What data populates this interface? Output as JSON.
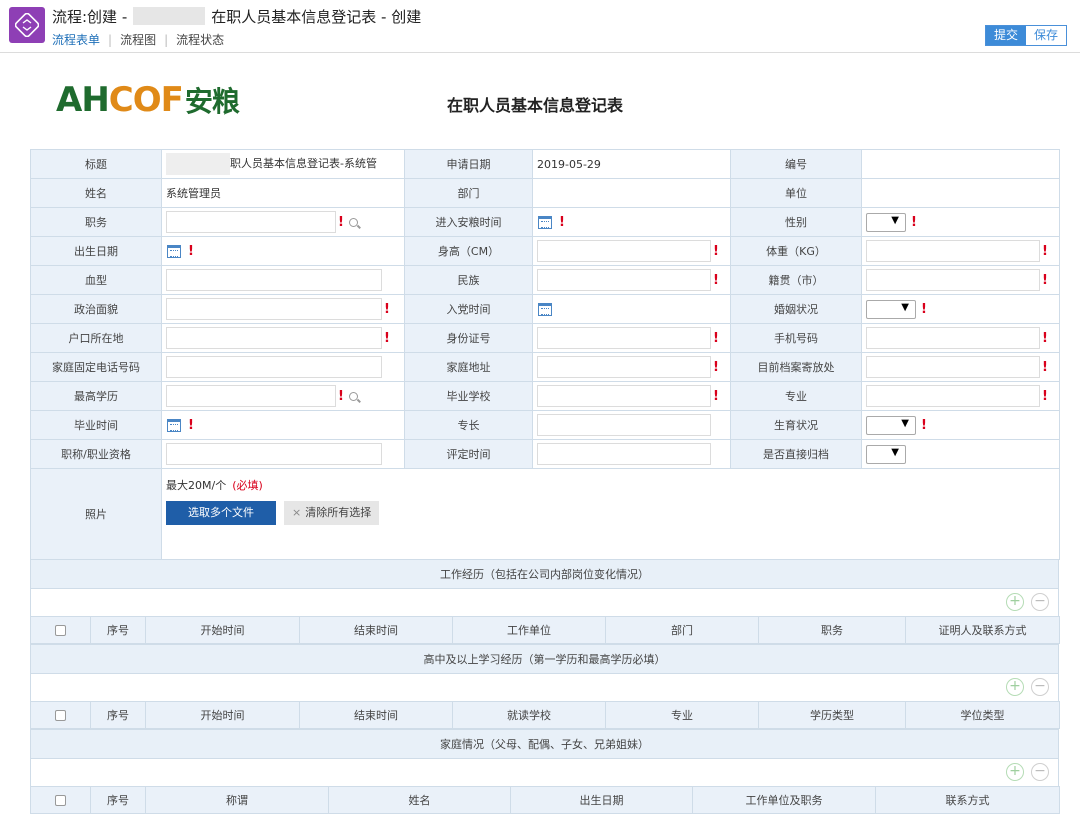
{
  "header": {
    "title_prefix": "流程:创建 -",
    "title_suffix": "在职人员基本信息登记表 - 创建",
    "tabs": [
      "流程表单",
      "流程图",
      "流程状态"
    ],
    "submit_label": "提交",
    "save_label": "保存"
  },
  "logo": {
    "ah": "AH",
    "cof": "COF",
    "cn": "安粮"
  },
  "form_title": "在职人员基本信息登记表",
  "form": {
    "title_label": "标题",
    "title_value": "职人员基本信息登记表-系统管",
    "apply_date_label": "申请日期",
    "apply_date_value": "2019-05-29",
    "number_label": "编号",
    "name_label": "姓名",
    "name_value": "系统管理员",
    "dept_label": "部门",
    "unit_label": "单位",
    "position_label": "职务",
    "join_date_label": "进入安粮时间",
    "gender_label": "性别",
    "birth_label": "出生日期",
    "height_label": "身高（CM）",
    "weight_label": "体重（KG）",
    "blood_label": "血型",
    "ethnic_label": "民族",
    "native_label": "籍贯（市）",
    "political_label": "政治面貌",
    "party_date_label": "入党时间",
    "marital_label": "婚姻状况",
    "hukou_label": "户口所在地",
    "id_label": "身份证号",
    "mobile_label": "手机号码",
    "home_phone_label": "家庭固定电话号码",
    "home_addr_label": "家庭地址",
    "archive_label": "目前档案寄放处",
    "edu_label": "最高学历",
    "school_label": "毕业学校",
    "major_label": "专业",
    "grad_date_label": "毕业时间",
    "specialty_label": "专长",
    "fertility_label": "生育状况",
    "title_qual_label": "职称/职业资格",
    "eval_date_label": "评定时间",
    "direct_archive_label": "是否直接归档",
    "photo_label": "照片",
    "photo_hint": "最大20M/个",
    "photo_required": "(必填)",
    "pick_files": "选取多个文件",
    "clear_all": "清除所有选择"
  },
  "work_history": {
    "title": "工作经历（包括在公司内部岗位变化情况）",
    "columns": [
      "序号",
      "开始时间",
      "结束时间",
      "工作单位",
      "部门",
      "职务",
      "证明人及联系方式"
    ]
  },
  "education": {
    "title": "高中及以上学习经历（第一学历和最高学历必填）",
    "columns": [
      "序号",
      "开始时间",
      "结束时间",
      "就读学校",
      "专业",
      "学历类型",
      "学位类型"
    ]
  },
  "family": {
    "title": "家庭情况（父母、配偶、子女、兄弟姐妹）",
    "columns": [
      "序号",
      "称谓",
      "姓名",
      "出生日期",
      "工作单位及职务",
      "联系方式"
    ]
  }
}
